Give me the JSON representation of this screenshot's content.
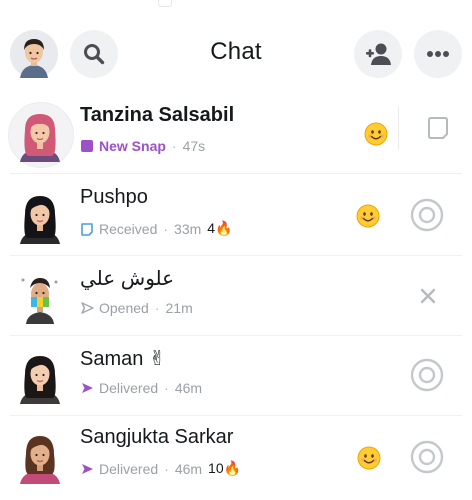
{
  "header": {
    "title": "Chat",
    "icons": {
      "profile": "profile-avatar",
      "search": "search-icon",
      "add_friend": "add-friend-icon",
      "more": "more-icon"
    }
  },
  "colors": {
    "new_snap_purple": "#9d51c8",
    "received_blue": "#4a9edb",
    "delivered_purple": "#9d51c8",
    "opened_gray": "#a5aab0",
    "button_bg": "#f0f1f3",
    "text": "#16191c",
    "muted": "#9aa0a6"
  },
  "chats": [
    {
      "name": "Tanzina Salsabil",
      "status": "New Snap",
      "time": "47s",
      "streak": "",
      "has_face_emoji": true,
      "right_icon": "chat-bubble-icon"
    },
    {
      "name": "Pushpo",
      "status": "Received",
      "time": "33m",
      "streak": "4🔥",
      "has_face_emoji": true,
      "right_icon": "camera-icon"
    },
    {
      "name": "علوش علي",
      "status": "Opened",
      "time": "21m",
      "streak": "",
      "has_face_emoji": false,
      "right_icon": "close-icon"
    },
    {
      "name": "Saman ✌",
      "status": "Delivered",
      "time": "46m",
      "streak": "",
      "has_face_emoji": false,
      "right_icon": "camera-icon"
    },
    {
      "name": "Sangjukta Sarkar",
      "status": "Delivered",
      "time": "46m",
      "streak": "10🔥",
      "has_face_emoji": true,
      "right_icon": "camera-icon"
    }
  ]
}
